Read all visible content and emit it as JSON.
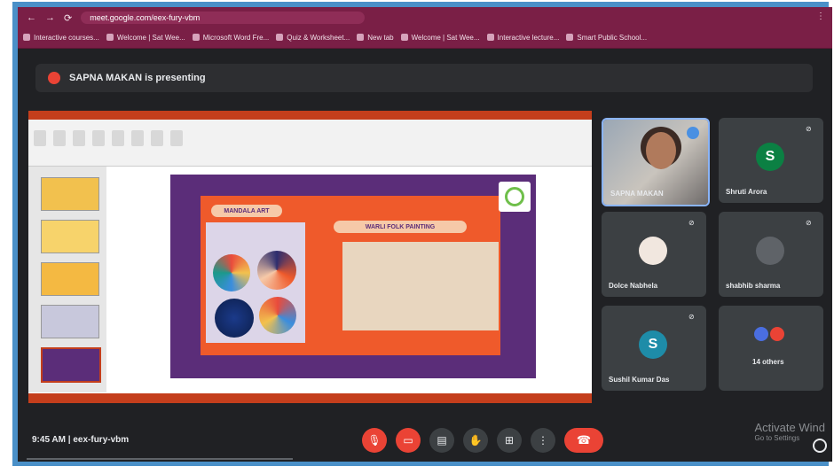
{
  "browser": {
    "url": "meet.google.com/eex-fury-vbm",
    "bookmarks": [
      {
        "label": "Interactive courses..."
      },
      {
        "label": "Welcome | Sat Wee..."
      },
      {
        "label": "Microsoft Word Fre..."
      },
      {
        "label": "Quiz & Worksheet..."
      },
      {
        "label": "New tab"
      },
      {
        "label": "Welcome | Sat Wee..."
      },
      {
        "label": "Interactive lecture..."
      },
      {
        "label": "Smart Public School..."
      }
    ]
  },
  "meet": {
    "presenting_text": "SAPNA MAKAN is presenting",
    "slide": {
      "left_label": "MANDALA ART",
      "right_label": "WARLI FOLK PAINTING"
    },
    "participants": [
      {
        "name": "SAPNA MAKAN",
        "initial": "",
        "color": "#8a9aa8"
      },
      {
        "name": "Shruti Arora",
        "initial": "S",
        "color": "#0b8043"
      },
      {
        "name": "Dolce Nabhela",
        "initial": "",
        "color": "#c8553d"
      },
      {
        "name": "shabhib sharma",
        "initial": "",
        "color": "#5f6368"
      },
      {
        "name": "Sushil Kumar Das",
        "initial": "S",
        "color": "#1e8ca8"
      },
      {
        "name": "14 others",
        "initial": "",
        "color": "#3c4043"
      }
    ],
    "meeting_time": "9:45 AM",
    "meeting_code": "eex-fury-vbm",
    "activate_title": "Activate Wind",
    "activate_sub": "Go to Settings"
  }
}
